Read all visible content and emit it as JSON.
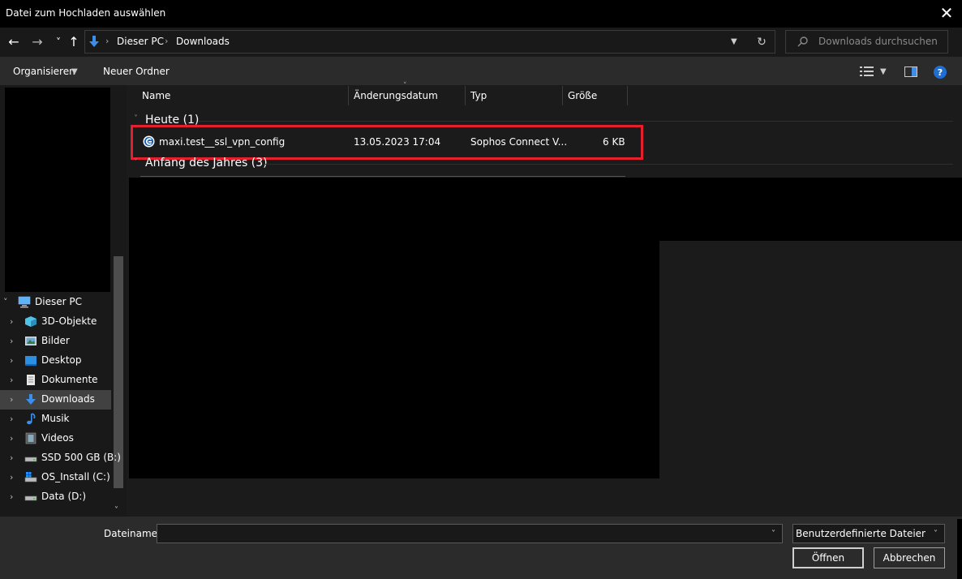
{
  "window": {
    "title": "Datei zum Hochladen auswählen"
  },
  "nav": {
    "back": "←",
    "forward": "→",
    "recent": "˅",
    "up": "↑",
    "breadcrumb": [
      "Dieser PC",
      "Downloads"
    ],
    "refresh": "↻",
    "search_placeholder": "Downloads durchsuchen"
  },
  "toolbar": {
    "organize": "Organisieren",
    "new_folder": "Neuer Ordner"
  },
  "sidebar": {
    "items": [
      {
        "label": "Dieser PC",
        "icon": "computer-icon"
      },
      {
        "label": "3D-Objekte",
        "icon": "cube-icon"
      },
      {
        "label": "Bilder",
        "icon": "pictures-icon"
      },
      {
        "label": "Desktop",
        "icon": "desktop-icon"
      },
      {
        "label": "Dokumente",
        "icon": "document-icon"
      },
      {
        "label": "Downloads",
        "icon": "download-icon"
      },
      {
        "label": "Musik",
        "icon": "music-icon"
      },
      {
        "label": "Videos",
        "icon": "video-icon"
      },
      {
        "label": "SSD 500 GB (B:)",
        "icon": "drive-icon"
      },
      {
        "label": "OS_Install (C:)",
        "icon": "windows-drive-icon"
      },
      {
        "label": "Data (D:)",
        "icon": "drive-icon"
      }
    ]
  },
  "columns": {
    "name": "Name",
    "modified": "Änderungsdatum",
    "type": "Typ",
    "size": "Größe"
  },
  "groups": [
    {
      "label": "Heute (1)"
    },
    {
      "label": "Anfang des Jahres (3)"
    }
  ],
  "files": [
    {
      "name": "maxi.test__ssl_vpn_config",
      "modified": "13.05.2023 17:04",
      "type": "Sophos Connect V...",
      "size": "6 KB",
      "icon": "sophos-connect-icon"
    }
  ],
  "footer": {
    "filename_label": "Dateiname:",
    "filename_value": "",
    "filter": "Benutzerdefinierte Dateien (*.scx)",
    "open": "Öffnen",
    "cancel": "Abbrechen"
  },
  "colors": {
    "highlight": "#e5202e",
    "accent": "#0078d7"
  }
}
